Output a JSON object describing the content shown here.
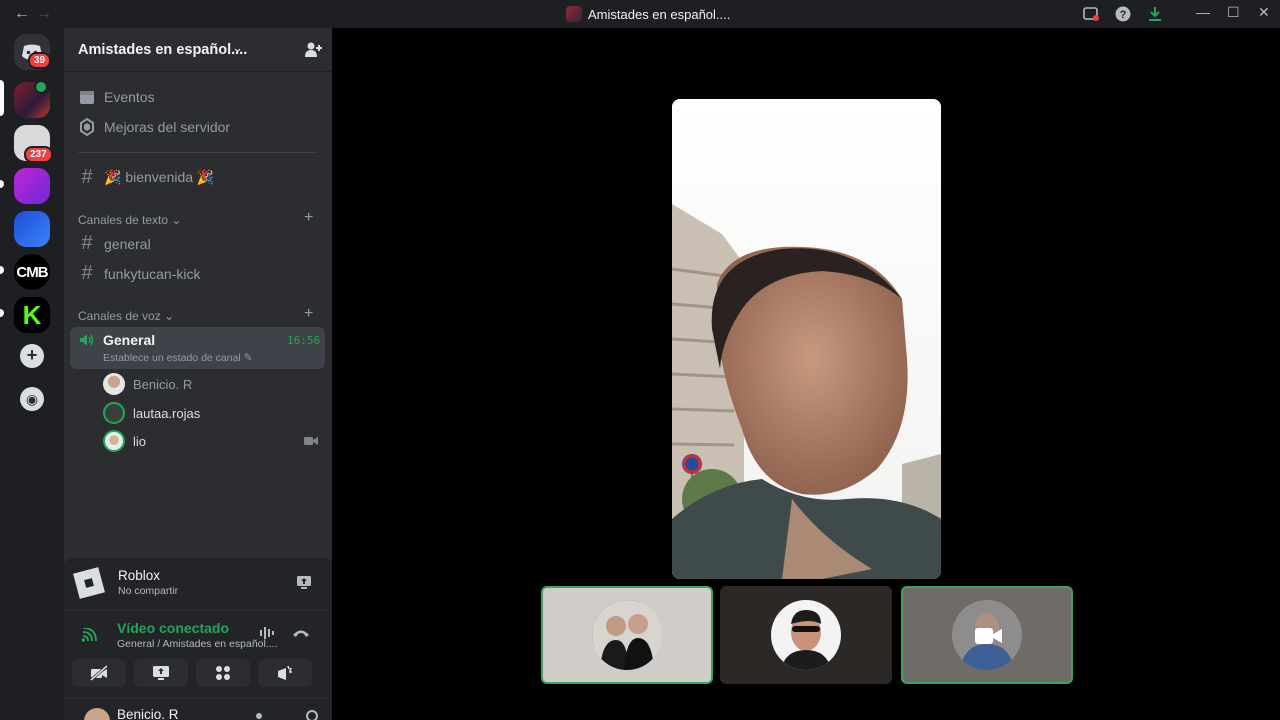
{
  "titlebar": {
    "back": "←",
    "forward": "→",
    "title": "Amistades en español....",
    "minimize": "—",
    "maximize": "☐",
    "close": "✕"
  },
  "rail": {
    "badges": {
      "home": "39",
      "server2": "237"
    },
    "cmb_label": "CMB",
    "k_label": "K",
    "add_label": "+",
    "discover_label": "◉"
  },
  "server": {
    "name": "Amistades en español....",
    "chevron": "⌄"
  },
  "nav": {
    "events": "Eventos",
    "boosts": "Mejoras del servidor",
    "welcome": "🎉 bienvenida 🎉"
  },
  "text_category": {
    "label": "Canales de texto",
    "chevron": "⌄",
    "add": "+"
  },
  "text_channels": [
    "general",
    "funkytucan-kick"
  ],
  "voice_category": {
    "label": "Canales de voz",
    "chevron": "⌄",
    "add": "+"
  },
  "voice_channel": {
    "name": "General",
    "timer": "16:56",
    "status": "Establece un estado de canal",
    "edit": "✎"
  },
  "voice_users": [
    {
      "name": "Benicio. R"
    },
    {
      "name": "lautaa.rojas"
    },
    {
      "name": "lio"
    }
  ],
  "activity": {
    "game": "Roblox",
    "sub": "No compartir"
  },
  "connection": {
    "status": "Vídeo conectado",
    "location": "General / Amistades en español...."
  },
  "current_user": {
    "name": "Benicio. R"
  },
  "colors": {
    "green": "#23a55a",
    "tile_border": "#3ba55c"
  }
}
